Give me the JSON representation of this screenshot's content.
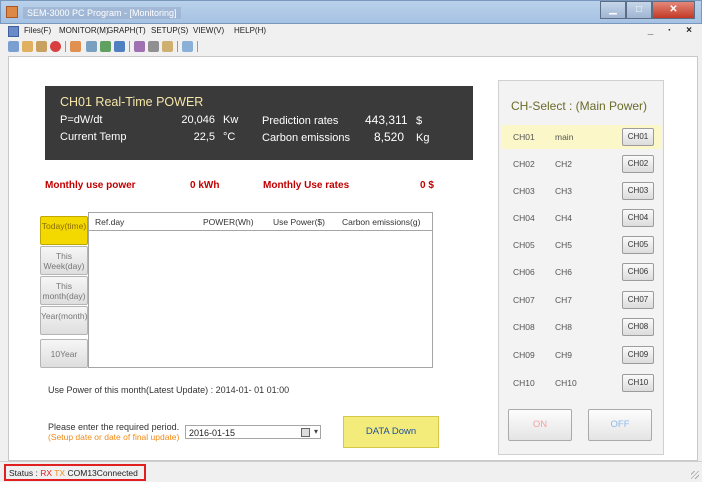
{
  "window": {
    "title": "SEM-3000 PC Program - [Monitoring]",
    "controls": [
      "minimize-icon",
      "maximize-icon",
      "close-icon"
    ]
  },
  "menu": {
    "items": [
      "Files(F)",
      "MONITOR(M)",
      "GRAPH(T)",
      "SETUP(S)",
      "VIEW(V)",
      "HELP(H)"
    ],
    "mdi_controls": "_ · ×"
  },
  "toolbar": {
    "icons": [
      "pen-icon",
      "brush-icon",
      "settings-icon",
      "stop-icon",
      "home-icon",
      "chart-icon",
      "line-chart-icon",
      "bar-chart-icon",
      "print-icon",
      "gear-icon",
      "edit-icon",
      "window-icon"
    ]
  },
  "realtime": {
    "title": "CH01  Real-Time POWER",
    "power_label": "P=dW/dt",
    "power_value": "20,046",
    "power_unit": "Kw",
    "temp_label": "Current Temp",
    "temp_value": "22,5",
    "temp_unit": "°C",
    "prediction_label": "Prediction rates",
    "prediction_value": "443,311",
    "prediction_unit": "$",
    "carbon_label": "Carbon emissions",
    "carbon_value": "8,520",
    "carbon_unit": "Kg"
  },
  "monthly": {
    "power_label": "Monthly use power",
    "power_value": "0 kWh",
    "rates_label": "Monthly Use rates",
    "rates_value": "0 $"
  },
  "periods": [
    {
      "label": "Today(time)",
      "active": true
    },
    {
      "label": "This Week(day)",
      "active": false
    },
    {
      "label": "This month(day)",
      "active": false
    },
    {
      "label": "Year(month)",
      "active": false
    },
    {
      "label": "10Year",
      "active": false
    }
  ],
  "table": {
    "columns": [
      "Ref.day",
      "POWER(Wh)",
      "Use Power($)",
      "Carbon emissions(g)"
    ],
    "rows": []
  },
  "latest_update": "Use Power of this month(Latest Update) :  2014-01- 01 01:00",
  "period_input": {
    "prompt": "Please enter the required period.",
    "hint": "(Setup date or date of final update)",
    "value": "2016-01-15",
    "button": "DATA Down"
  },
  "channels": {
    "title": "CH-Select : (Main Power)",
    "list": [
      {
        "no": "CH01",
        "name": "main",
        "button": "CH01",
        "selected": true
      },
      {
        "no": "CH02",
        "name": "CH2",
        "button": "CH02",
        "selected": false
      },
      {
        "no": "CH03",
        "name": "CH3",
        "button": "CH03",
        "selected": false
      },
      {
        "no": "CH04",
        "name": "CH4",
        "button": "CH04",
        "selected": false
      },
      {
        "no": "CH05",
        "name": "CH5",
        "button": "CH05",
        "selected": false
      },
      {
        "no": "CH06",
        "name": "CH6",
        "button": "CH06",
        "selected": false
      },
      {
        "no": "CH07",
        "name": "CH7",
        "button": "CH07",
        "selected": false
      },
      {
        "no": "CH08",
        "name": "CH8",
        "button": "CH08",
        "selected": false
      },
      {
        "no": "CH09",
        "name": "CH9",
        "button": "CH09",
        "selected": false
      },
      {
        "no": "CH10",
        "name": "CH10",
        "button": "CH10",
        "selected": false
      }
    ],
    "on_label": "ON",
    "off_label": "OFF"
  },
  "status": {
    "label": "Status :",
    "rx": "RX",
    "tx": "TX",
    "text": "COM13Connected"
  },
  "colors": {
    "realtime_bg": "#3a3a3a",
    "realtime_title": "#f5e6a8",
    "monthly_red": "#c00000",
    "active_tab": "#f4d900",
    "data_down_bg": "#f4ec7a",
    "ch_selected": "#fbf7c8",
    "on_color": "#f4a0a0",
    "off_color": "#8ab8ec",
    "status_border": "#e02020"
  }
}
